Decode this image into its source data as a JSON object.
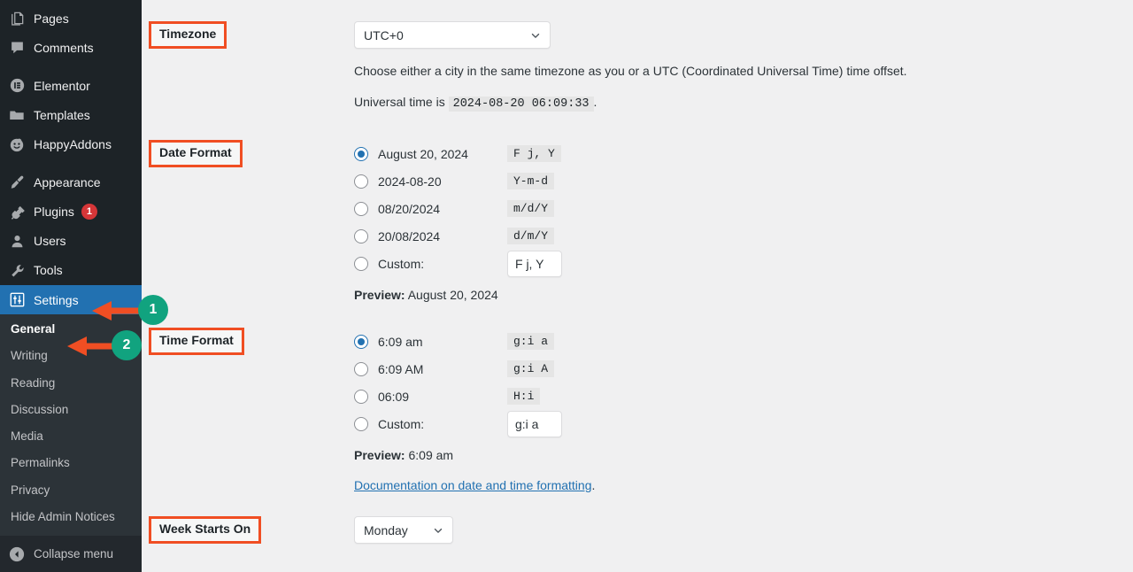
{
  "sidebar": {
    "items": [
      {
        "label": "Pages",
        "icon": "pages-icon",
        "badge": null,
        "active": false
      },
      {
        "label": "Comments",
        "icon": "comments-icon",
        "badge": null,
        "active": false
      },
      {
        "label": "Elementor",
        "icon": "elementor-icon",
        "badge": null,
        "active": false
      },
      {
        "label": "Templates",
        "icon": "templates-folder-icon",
        "badge": null,
        "active": false
      },
      {
        "label": "HappyAddons",
        "icon": "happyaddons-smiley-icon",
        "badge": null,
        "active": false
      },
      {
        "label": "Appearance",
        "icon": "appearance-brush-icon",
        "badge": null,
        "active": false
      },
      {
        "label": "Plugins",
        "icon": "plugins-plug-icon",
        "badge": "1",
        "active": false
      },
      {
        "label": "Users",
        "icon": "users-icon",
        "badge": null,
        "active": false
      },
      {
        "label": "Tools",
        "icon": "tools-wrench-icon",
        "badge": null,
        "active": false
      },
      {
        "label": "Settings",
        "icon": "settings-sliders-icon",
        "badge": null,
        "active": true
      }
    ],
    "submenu": [
      {
        "label": "General",
        "current": true
      },
      {
        "label": "Writing",
        "current": false
      },
      {
        "label": "Reading",
        "current": false
      },
      {
        "label": "Discussion",
        "current": false
      },
      {
        "label": "Media",
        "current": false
      },
      {
        "label": "Permalinks",
        "current": false
      },
      {
        "label": "Privacy",
        "current": false
      },
      {
        "label": "Hide Admin Notices",
        "current": false
      }
    ],
    "collapse": {
      "label": "Collapse menu",
      "icon": "collapse-left-arrow-icon"
    }
  },
  "settings": {
    "timezone": {
      "label": "Timezone",
      "selected": "UTC+0",
      "description": "Choose either a city in the same timezone as you or a UTC (Coordinated Universal Time) time offset.",
      "universal_time_prefix": "Universal time is",
      "universal_time_value": "2024-08-20 06:09:33",
      "universal_time_suffix": "."
    },
    "date_format": {
      "label": "Date Format",
      "options": [
        {
          "text": "August 20, 2024",
          "code": "F j, Y",
          "checked": true
        },
        {
          "text": "2024-08-20",
          "code": "Y-m-d",
          "checked": false
        },
        {
          "text": "08/20/2024",
          "code": "m/d/Y",
          "checked": false
        },
        {
          "text": "20/08/2024",
          "code": "d/m/Y",
          "checked": false
        }
      ],
      "custom_label": "Custom:",
      "custom_value": "F j, Y",
      "preview_label": "Preview:",
      "preview_value": "August 20, 2024"
    },
    "time_format": {
      "label": "Time Format",
      "options": [
        {
          "text": "6:09 am",
          "code": "g:i a",
          "checked": true
        },
        {
          "text": "6:09 AM",
          "code": "g:i A",
          "checked": false
        },
        {
          "text": "06:09",
          "code": "H:i",
          "checked": false
        }
      ],
      "custom_label": "Custom:",
      "custom_value": "g:i a",
      "preview_label": "Preview:",
      "preview_value": "6:09 am"
    },
    "doc_link": {
      "text": "Documentation on date and time formatting",
      "trailing": "."
    },
    "week_starts_on": {
      "label": "Week Starts On",
      "selected": "Monday"
    }
  },
  "annotations": {
    "badges": [
      {
        "number": "1"
      },
      {
        "number": "2"
      }
    ],
    "highlight_color": "#f04e23",
    "badge_color": "#11a37f"
  }
}
